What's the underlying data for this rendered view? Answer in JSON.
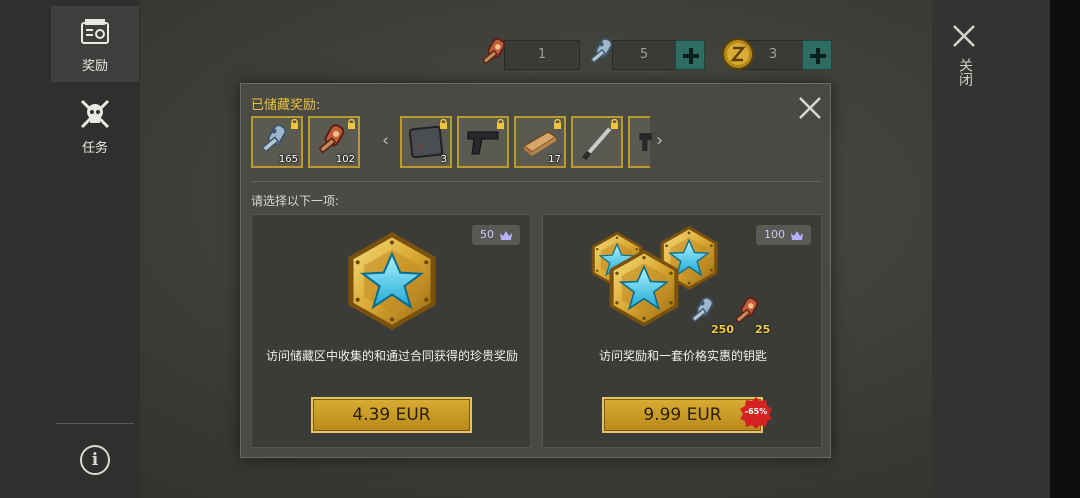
{
  "sidebar": {
    "tabs": [
      {
        "label": "奖励",
        "icon": "reward-crate-icon",
        "active": true
      },
      {
        "label": "任务",
        "icon": "skull-crossbones-icon",
        "active": false
      }
    ],
    "info_icon": "info-icon"
  },
  "currency": [
    {
      "icon": "red-keycard-icon",
      "value": "1"
    },
    {
      "icon": "blue-keycard-icon",
      "value": "5"
    },
    {
      "icon": "gold-coin-icon",
      "value": "3"
    }
  ],
  "close": {
    "label": "关闭",
    "icon": "close-icon"
  },
  "dialog": {
    "stored_title": "已储藏奖励:",
    "stored_items": [
      {
        "icon": "blue-keycards-icon",
        "count": "165",
        "locked": true
      },
      {
        "icon": "red-keycards-icon",
        "count": "102",
        "locked": true
      },
      {
        "icon": "metal-plate-icon",
        "count": "3",
        "locked": true
      },
      {
        "icon": "pistol-icon",
        "count": "",
        "locked": true
      },
      {
        "icon": "wood-plank-icon",
        "count": "17",
        "locked": true
      },
      {
        "icon": "machete-icon",
        "count": "",
        "locked": true
      },
      {
        "icon": "rifle-partial-icon",
        "count": "",
        "locked": false
      }
    ],
    "prev_icon": "chevron-left-icon",
    "next_icon": "chevron-right-icon",
    "choose_label": "请选择以下一项:",
    "offers": [
      {
        "badge": "50",
        "badge_icon": "crown-icon",
        "art": "gold-star-badge-icon",
        "description": "访问储藏区中收集的和通过合同获得的珍贵奖励",
        "price": "4.39 EUR"
      },
      {
        "badge": "100",
        "badge_icon": "crown-icon",
        "art": "gold-star-badge-bundle-icon",
        "blue_keys": "250",
        "red_keys": "25",
        "description": "访问奖励和一套价格实惠的钥匙",
        "price": "9.99 EUR",
        "discount": "-65%"
      }
    ]
  },
  "colors": {
    "accent_gold": "#e8c440",
    "plus_teal": "#2f6c63",
    "discount_red": "#d42222"
  }
}
